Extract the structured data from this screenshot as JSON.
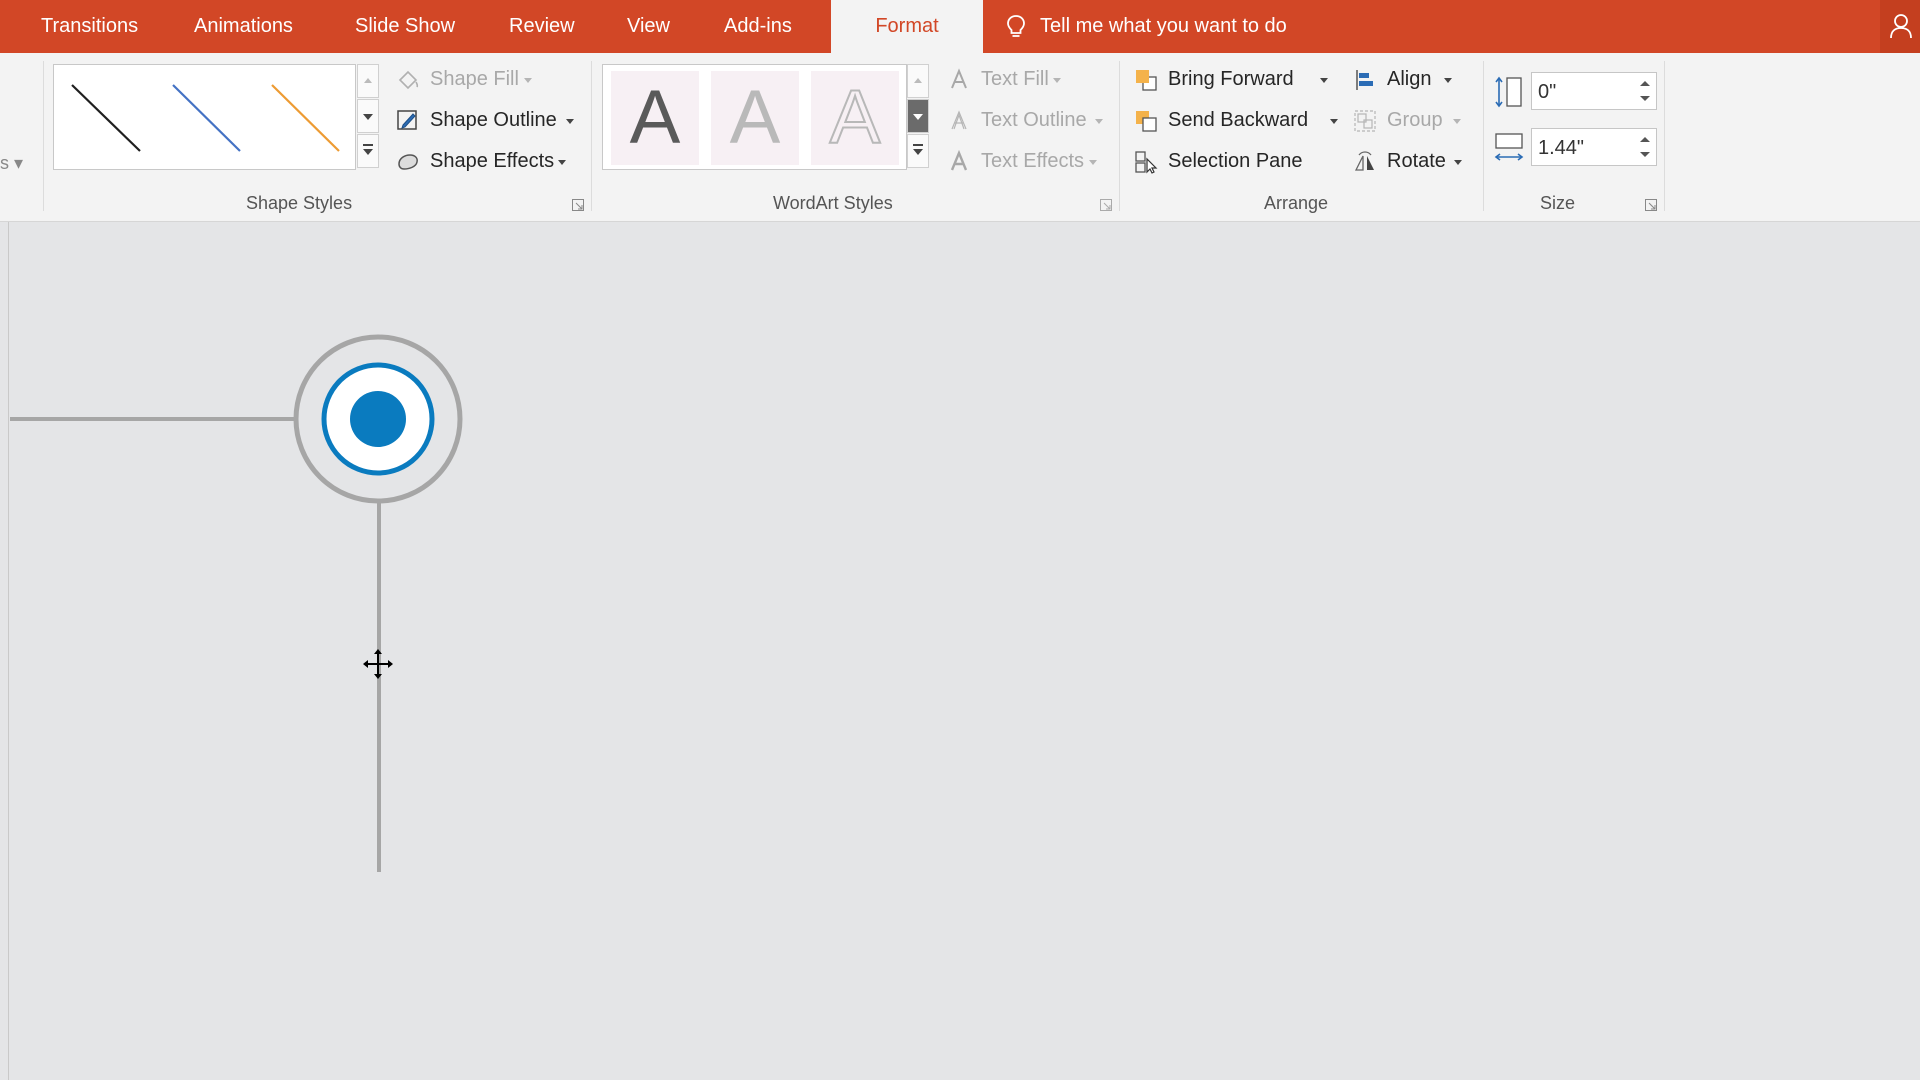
{
  "tabs": [
    {
      "label": "Transitions",
      "active": false
    },
    {
      "label": "Animations",
      "active": false
    },
    {
      "label": "Slide Show",
      "active": false
    },
    {
      "label": "Review",
      "active": false
    },
    {
      "label": "View",
      "active": false
    },
    {
      "label": "Add-ins",
      "active": false
    },
    {
      "label": "Format",
      "active": true
    }
  ],
  "tell_me": {
    "placeholder": "Tell me what you want to do"
  },
  "colors": {
    "accent": "#d24726",
    "ribbon_bg": "#f3f3f3",
    "canvas_bg": "#e4e5e7",
    "target_blue": "#0a7bbf",
    "connector_gray": "#a6a6a6"
  },
  "shape_styles": {
    "group_label": "Shape Styles",
    "gallery_line_colors": [
      "#1f1f1f",
      "#4472c4",
      "#ed9b33"
    ],
    "shape_fill": "Shape Fill",
    "shape_outline": "Shape Outline",
    "shape_effects": "Shape Effects"
  },
  "wordart_styles": {
    "group_label": "WordArt Styles",
    "gallery_letters": [
      "A",
      "A",
      "A"
    ],
    "text_fill": "Text Fill",
    "text_outline": "Text Outline",
    "text_effects": "Text Effects"
  },
  "arrange": {
    "group_label": "Arrange",
    "bring_forward": "Bring Forward",
    "send_backward": "Send Backward",
    "selection_pane": "Selection Pane",
    "align": "Align",
    "group": "Group",
    "rotate": "Rotate"
  },
  "size": {
    "group_label": "Size",
    "height_value": "0\"",
    "width_value": "1.44\""
  },
  "icons": {
    "tell_me": "lightbulb-icon",
    "account": "person-icon",
    "cursor": "move-cursor-icon"
  }
}
